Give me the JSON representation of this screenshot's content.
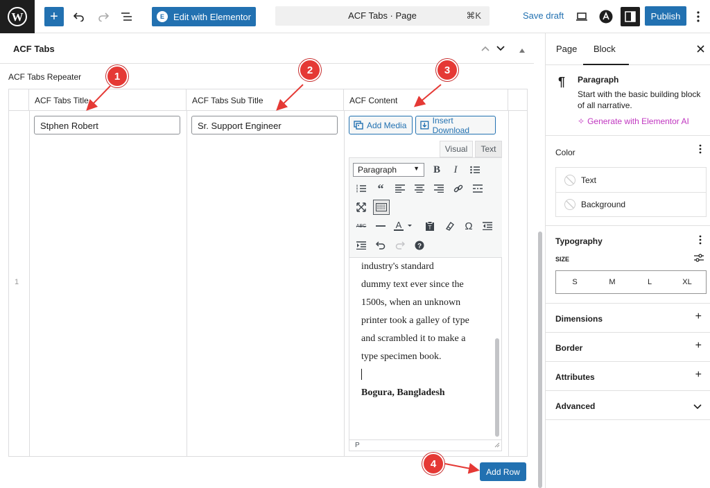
{
  "topbar": {
    "elementor_label": "Edit with Elementor",
    "command_title": "ACF Tabs · Page",
    "command_shortcut": "⌘K",
    "save_draft": "Save draft",
    "publish": "Publish"
  },
  "main": {
    "panel_title": "ACF Tabs",
    "repeater_label": "ACF Tabs Repeater",
    "columns": [
      "ACF Tabs Title",
      "ACF Tabs Sub Title",
      "ACF Content"
    ],
    "row_number": "1",
    "title_value": "Stphen Robert",
    "subtitle_value": "Sr. Support Engineer",
    "add_media": "Add Media",
    "insert_download": "Insert Download",
    "tab_visual": "Visual",
    "tab_text": "Text",
    "format_select": "Paragraph",
    "content_lines": [
      "industry's standard",
      "dummy text ever since the",
      "1500s, when an unknown",
      "printer took a galley of type",
      "and scrambled it to make a",
      "type specimen book."
    ],
    "content_bold": "Bogura, Bangladesh",
    "status_path": "P",
    "add_row": "Add Row"
  },
  "annotations": [
    "1",
    "2",
    "3",
    "4"
  ],
  "annotation_color": "#e53935",
  "sidebar": {
    "tabs": [
      "Page",
      "Block"
    ],
    "block_name": "Paragraph",
    "block_desc_1": "Start with the basic building block",
    "block_desc_2": "of all narrative.",
    "generate_ai": "Generate with Elementor AI",
    "color_title": "Color",
    "color_items": [
      "Text",
      "Background"
    ],
    "typography_title": "Typography",
    "size_label": "SIZE",
    "sizes": [
      "S",
      "M",
      "L",
      "XL"
    ],
    "sections": [
      "Dimensions",
      "Border",
      "Attributes",
      "Advanced"
    ]
  },
  "colors": {
    "accent": "#2271b1",
    "ai": "#c036c0"
  }
}
